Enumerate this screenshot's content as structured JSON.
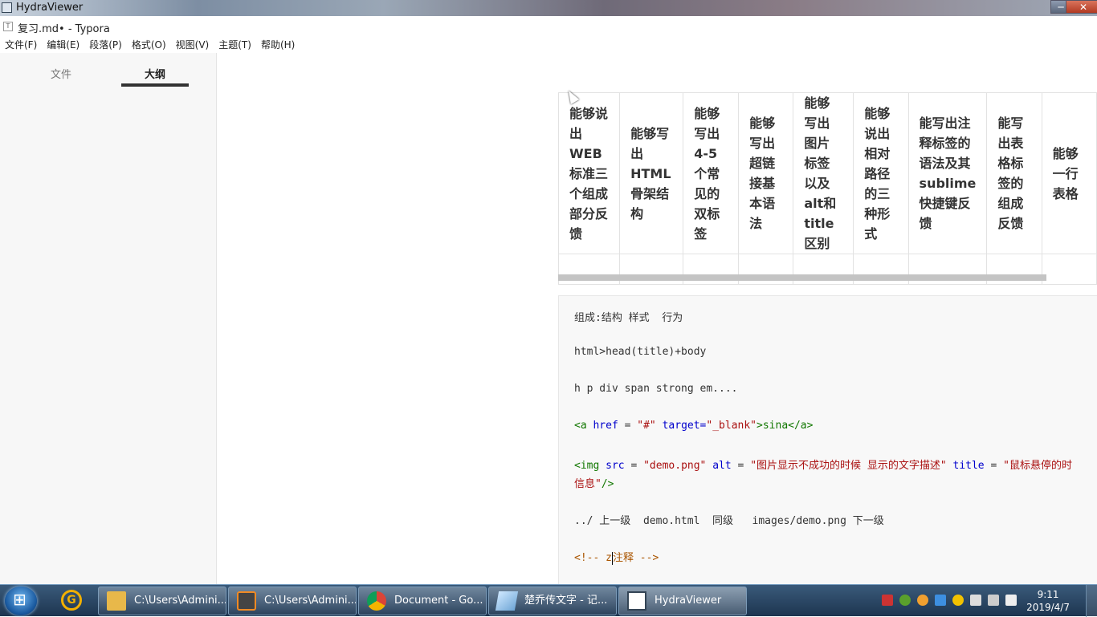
{
  "hydra": {
    "title": "HydraViewer",
    "minimize_icon": "minimize-icon",
    "maximize_icon": "maximize-icon",
    "close_icon": "close-icon"
  },
  "window": {
    "title": "复习.md• - Typora"
  },
  "menu": [
    "文件(F)",
    "编辑(E)",
    "段落(P)",
    "格式(O)",
    "视图(V)",
    "主题(T)",
    "帮助(H)"
  ],
  "sidebar": {
    "tab_files": "文件",
    "tab_outline": "大纲"
  },
  "table": {
    "headers": [
      "能够说出WEB标准三个组成部分反馈",
      "能够写出HTML骨架结构",
      "能够写出4-5个常见的双标签",
      "能够写出超链接基本语法",
      "能够写出图片标签以及alt和title区别",
      "能够说出相对路径的三种形式",
      "能写出注释标签的语法及其sublime快捷键反馈",
      "能写出表格标签的组成反馈",
      "能够一行表格"
    ]
  },
  "code_block": {
    "l1": "组成:结构 样式  行为",
    "l2": "html>head(title)+body",
    "l3": "h p div span strong em....",
    "l4": {
      "a": "<a",
      "b": " href",
      "c": " = ",
      "d": "\"#\"",
      "e": " target=",
      "f": "\"_blank\"",
      "g": ">sina</a>"
    },
    "l5": {
      "a": "<img",
      "b": " src",
      "c": " = ",
      "d": "\"demo.png\"",
      "e": " alt",
      "f": " = ",
      "g": "\"图片显示不成功的时候 显示的文字描述\"",
      "h": " title",
      "i": " = ",
      "j": "\"鼠标悬停的时",
      "k": "信息\"",
      "l": "/>"
    },
    "l6": "../ 上一级  demo.html  同级   images/demo.png 下一级",
    "l7a": "<!-- z",
    "l7b": "注释 -->"
  },
  "taskbar": {
    "items": [
      "C:\\Users\\Admini...",
      "C:\\Users\\Admini...",
      "Document - Go...",
      "楚乔传文字 - 记...",
      "HydraViewer"
    ],
    "time": "9:11",
    "date": "2019/4/7"
  }
}
